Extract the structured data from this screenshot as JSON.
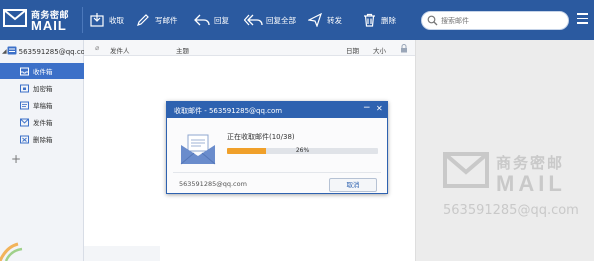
{
  "app": {
    "logo_cn": "商务密邮",
    "logo_en": "MAIL"
  },
  "toolbar": {
    "receive": "收取",
    "compose": "写邮件",
    "reply": "回复",
    "reply_all": "回复全部",
    "forward": "转发",
    "delete": "删除",
    "search_placeholder": "搜索邮件"
  },
  "sidebar": {
    "account": "563591285@qq.com",
    "items": [
      {
        "label": "收件箱",
        "icon": "inbox-icon",
        "active": true
      },
      {
        "label": "加密箱",
        "icon": "encrypted-box-icon",
        "active": false
      },
      {
        "label": "草稿箱",
        "icon": "drafts-icon",
        "active": false
      },
      {
        "label": "发件箱",
        "icon": "outbox-icon",
        "active": false
      },
      {
        "label": "删除箱",
        "icon": "trash-box-icon",
        "active": false
      }
    ]
  },
  "list": {
    "columns": {
      "sender": "发件人",
      "subject": "主题",
      "date": "日期",
      "size": "大小"
    }
  },
  "preview": {
    "watermark_cn": "商务密邮",
    "watermark_en": "MAIL",
    "watermark_account": "563591285@qq.com"
  },
  "dialog": {
    "title": "收取邮件 - 563591285@qq.com",
    "status": "正在收取邮件(10/38)",
    "progress_percent": 26,
    "progress_label": "26%",
    "account": "563591285@qq.com",
    "cancel": "取消"
  },
  "colors": {
    "toolbar_bg": "#2b5aa0",
    "accent": "#3c70c8",
    "progress_fill": "#f0a02a"
  }
}
